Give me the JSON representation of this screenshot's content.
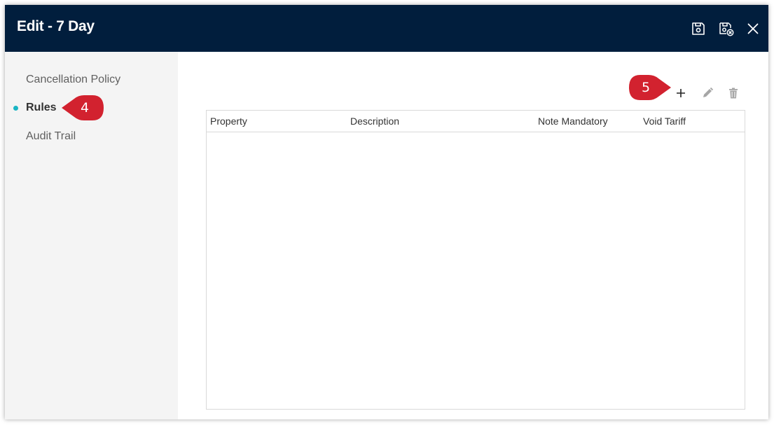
{
  "dialog": {
    "title": "Edit - 7 Day",
    "header_icons": [
      "save-icon",
      "save-and-close-icon",
      "close-icon"
    ]
  },
  "sidebar": {
    "items": [
      {
        "label": "Cancellation Policy",
        "active": false
      },
      {
        "label": "Rules",
        "active": true
      },
      {
        "label": "Audit Trail",
        "active": false
      }
    ]
  },
  "toolbar": {
    "icons": [
      "add-icon",
      "edit-icon",
      "delete-icon"
    ]
  },
  "grid": {
    "columns": [
      "Property",
      "Description",
      "Note Mandatory",
      "Void Tariff"
    ],
    "rows": []
  },
  "annotations": {
    "callout_rules": "4",
    "callout_add": "5"
  },
  "colors": {
    "header_bg": "#011e3d",
    "sidebar_bg": "#f4f4f4",
    "active_dot": "#19b5c4",
    "callout_red": "#d2222f"
  }
}
